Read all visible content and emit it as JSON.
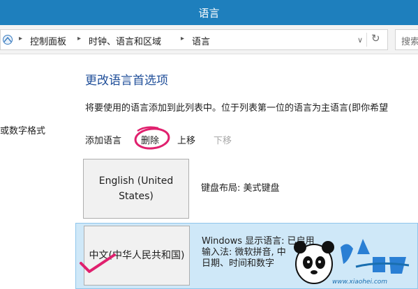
{
  "window": {
    "title": "语言"
  },
  "address_bar": {
    "breadcrumbs": [
      "控制面板",
      "时钟、语言和区域",
      "语言"
    ],
    "search_placeholder": "搜索"
  },
  "sidebar": {
    "partial_link": "或数字格式"
  },
  "main": {
    "title": "更改语言首选项",
    "description": "将要使用的语言添加到此列表中。位于列表第一位的语言为主语言(即你希望",
    "toolbar": {
      "add": "添加语言",
      "remove": "删除",
      "up": "上移",
      "down": "下移"
    },
    "languages": [
      {
        "name": "English (United States)",
        "info": [
          "键盘布局: 美式键盘"
        ]
      },
      {
        "name": "中文(中华人民共和国)",
        "info": [
          "Windows 显示语言: 已启用",
          "输入法: 微软拼音, 中",
          "日期、时间和数字"
        ]
      }
    ]
  },
  "annotations": {
    "circle_color": "#e0206e",
    "check_color": "#e0206e"
  },
  "watermark": {
    "text": "www.xiaohei.com"
  },
  "icons": [
    "back-arrow-icon",
    "refresh-icon",
    "chevron-down-icon",
    "panda-logo-icon"
  ],
  "colors": {
    "titlebar": "#1e7fbd",
    "page_title": "#1f4e99",
    "selected_row": "#cfe8f8"
  }
}
